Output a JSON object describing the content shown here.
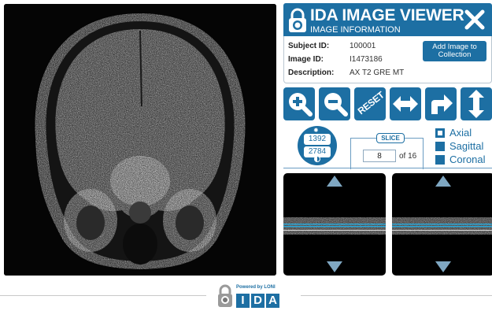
{
  "header": {
    "title": "IDA IMAGE VIEWER",
    "subtitle": "IMAGE INFORMATION"
  },
  "info": {
    "subject_id_label": "Subject ID:",
    "subject_id": "100001",
    "image_id_label": "Image ID:",
    "image_id": "I1473186",
    "description_label": "Description:",
    "description": "AX T2 GRE MT",
    "add_button": "Add Image to Collection"
  },
  "tools": {
    "reset": "RESET",
    "icons": [
      "zoom-in-icon",
      "zoom-out-icon",
      "reset-icon",
      "pan-horizontal-icon",
      "rotate-icon",
      "pan-vertical-icon"
    ]
  },
  "window_level": {
    "window": "1392",
    "level": "2784"
  },
  "slice": {
    "label": "SLICE",
    "current": "8",
    "total_text": "of 16"
  },
  "planes": {
    "axial": "Axial",
    "sagittal": "Sagittal",
    "coronal": "Coronal",
    "selected": "Axial"
  },
  "footer": {
    "powered_by": "Powered by LONI",
    "letters": [
      "I",
      "D",
      "A"
    ]
  },
  "colors": {
    "brand_blue": "#1d6fa3",
    "slice_marker": "#2aa7d8"
  }
}
